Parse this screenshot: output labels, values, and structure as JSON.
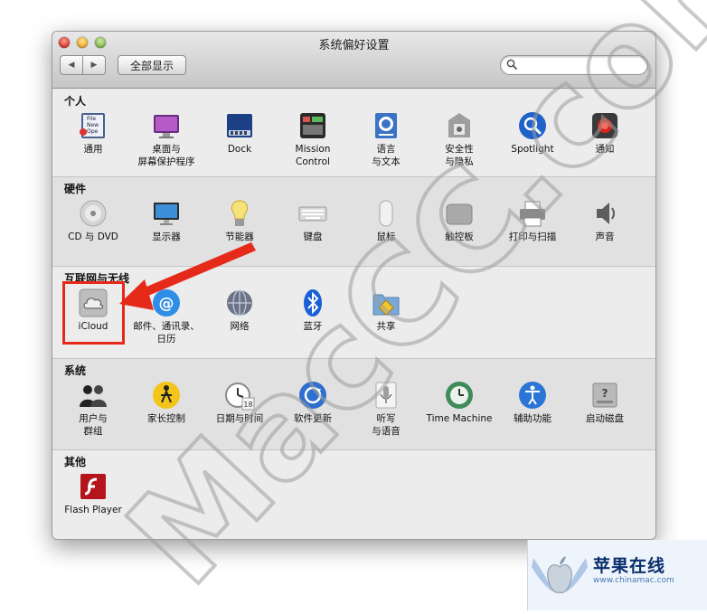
{
  "window": {
    "title": "系统偏好设置"
  },
  "toolbar": {
    "back_label": "◀",
    "forward_label": "▶",
    "show_all_label": "全部显示",
    "search_value": ""
  },
  "sections": [
    {
      "title": "个人",
      "items": [
        {
          "label": "通用",
          "icon": "general-icon"
        },
        {
          "label": "桌面与\n屏幕保护程序",
          "icon": "desktop-icon"
        },
        {
          "label": "Dock",
          "icon": "dock-icon"
        },
        {
          "label": "Mission\nControl",
          "icon": "mission-control-icon"
        },
        {
          "label": "语言\n与文本",
          "icon": "language-icon"
        },
        {
          "label": "安全性\n与隐私",
          "icon": "security-icon"
        },
        {
          "label": "Spotlight",
          "icon": "spotlight-icon"
        },
        {
          "label": "通知",
          "icon": "notifications-icon"
        }
      ]
    },
    {
      "title": "硬件",
      "items": [
        {
          "label": "CD 与 DVD",
          "icon": "cd-icon"
        },
        {
          "label": "显示器",
          "icon": "display-icon"
        },
        {
          "label": "节能器",
          "icon": "energy-saver-icon"
        },
        {
          "label": "键盘",
          "icon": "keyboard-icon"
        },
        {
          "label": "鼠标",
          "icon": "mouse-icon"
        },
        {
          "label": "触控板",
          "icon": "trackpad-icon"
        },
        {
          "label": "打印与扫描",
          "icon": "printer-icon"
        },
        {
          "label": "声音",
          "icon": "sound-icon"
        }
      ]
    },
    {
      "title": "互联网与无线",
      "items": [
        {
          "label": "iCloud",
          "icon": "icloud-icon"
        },
        {
          "label": "邮件、通讯录、\n日历",
          "icon": "mail-icon"
        },
        {
          "label": "网络",
          "icon": "network-icon"
        },
        {
          "label": "蓝牙",
          "icon": "bluetooth-icon"
        },
        {
          "label": "共享",
          "icon": "sharing-icon"
        }
      ]
    },
    {
      "title": "系统",
      "items": [
        {
          "label": "用户与\n群组",
          "icon": "users-icon"
        },
        {
          "label": "家长控制",
          "icon": "parental-controls-icon"
        },
        {
          "label": "日期与时间",
          "icon": "date-time-icon"
        },
        {
          "label": "软件更新",
          "icon": "software-update-icon"
        },
        {
          "label": "听写\n与语音",
          "icon": "dictation-icon"
        },
        {
          "label": "Time Machine",
          "icon": "time-machine-icon"
        },
        {
          "label": "辅助功能",
          "icon": "accessibility-icon"
        },
        {
          "label": "启动磁盘",
          "icon": "startup-disk-icon"
        }
      ]
    },
    {
      "title": "其他",
      "items": [
        {
          "label": "Flash Player",
          "icon": "flash-player-icon"
        }
      ]
    }
  ],
  "general_icon_text": [
    "File",
    "New",
    "Ope"
  ],
  "date_icon_day": "18",
  "watermark_text": "MacCC.com",
  "corner_logo": {
    "name": "苹果在线",
    "url": "www.chinamac.com"
  },
  "colors": {
    "highlight_red": "#e52a1a",
    "window_bg": "#ececec",
    "alt_section_bg": "#e1e1e1"
  }
}
